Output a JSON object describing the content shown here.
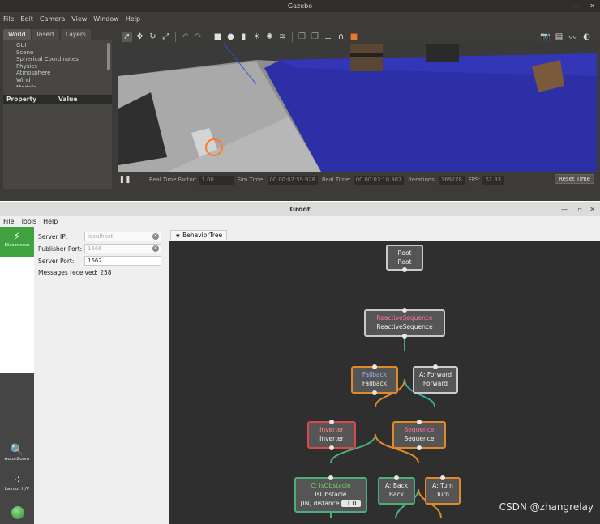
{
  "gazebo": {
    "title": "Gazebo",
    "menu": [
      "File",
      "Edit",
      "Camera",
      "View",
      "Window",
      "Help"
    ],
    "tabs": [
      "World",
      "Insert",
      "Layers"
    ],
    "world_items": [
      "GUI",
      "Scene",
      "Spherical Coordinates",
      "Physics",
      "Atmosphere",
      "Wind",
      "Models"
    ],
    "prop_headers": [
      "Property",
      "Value"
    ],
    "status": {
      "real_time_factor_label": "Real Time Factor:",
      "real_time_factor": "1.00",
      "sim_time_label": "Sim Time:",
      "sim_time": "00 00:02:59.928",
      "real_time_label": "Real Time:",
      "real_time": "00 00:03:10.307",
      "iterations_label": "Iterations:",
      "iterations": "169278",
      "fps_label": "FPS:",
      "fps": "62.33",
      "reset_label": "Reset Time"
    }
  },
  "groot": {
    "title": "Groot",
    "menu": [
      "File",
      "Tools",
      "Help"
    ],
    "disconnect_label": "Disconnect",
    "server_ip_label": "Server IP:",
    "server_ip": "localhost",
    "publisher_port_label": "Publisher Port:",
    "publisher_port": "1666",
    "server_port_label": "Server Port:",
    "server_port": "1667",
    "messages_received": "Messages received: 258",
    "autozoom_label": "Auto-Zoom",
    "layout_label": "Layout H/V",
    "tree_tab": "BehaviorTree",
    "nodes": {
      "root": {
        "head": "Root",
        "sub": "Root"
      },
      "reactive": {
        "head": "ReactiveSequence",
        "sub": "ReactiveSequence"
      },
      "fallback": {
        "head": "Fallback",
        "sub": "Fallback"
      },
      "forward": {
        "head": "A: Forward",
        "sub": "Forward"
      },
      "inverter": {
        "head": "Inverter",
        "sub": "Inverter"
      },
      "sequence": {
        "head": "Sequence",
        "sub": "Sequence"
      },
      "isobstacle": {
        "head": "C: IsObstacle",
        "sub": "IsObstacle",
        "port_label": "[IN] distance",
        "port_value": "1.0"
      },
      "back": {
        "head": "A: Back",
        "sub": "Back"
      },
      "turn": {
        "head": "A: Turn",
        "sub": "Turn"
      }
    },
    "colors": {
      "success": "#4caf7a",
      "running": "#e08a2a",
      "failure": "#d84a4a",
      "idle": "#c9c9c9",
      "edge_teal": "#3aa7a0"
    }
  },
  "watermark": "CSDN @zhangrelay"
}
